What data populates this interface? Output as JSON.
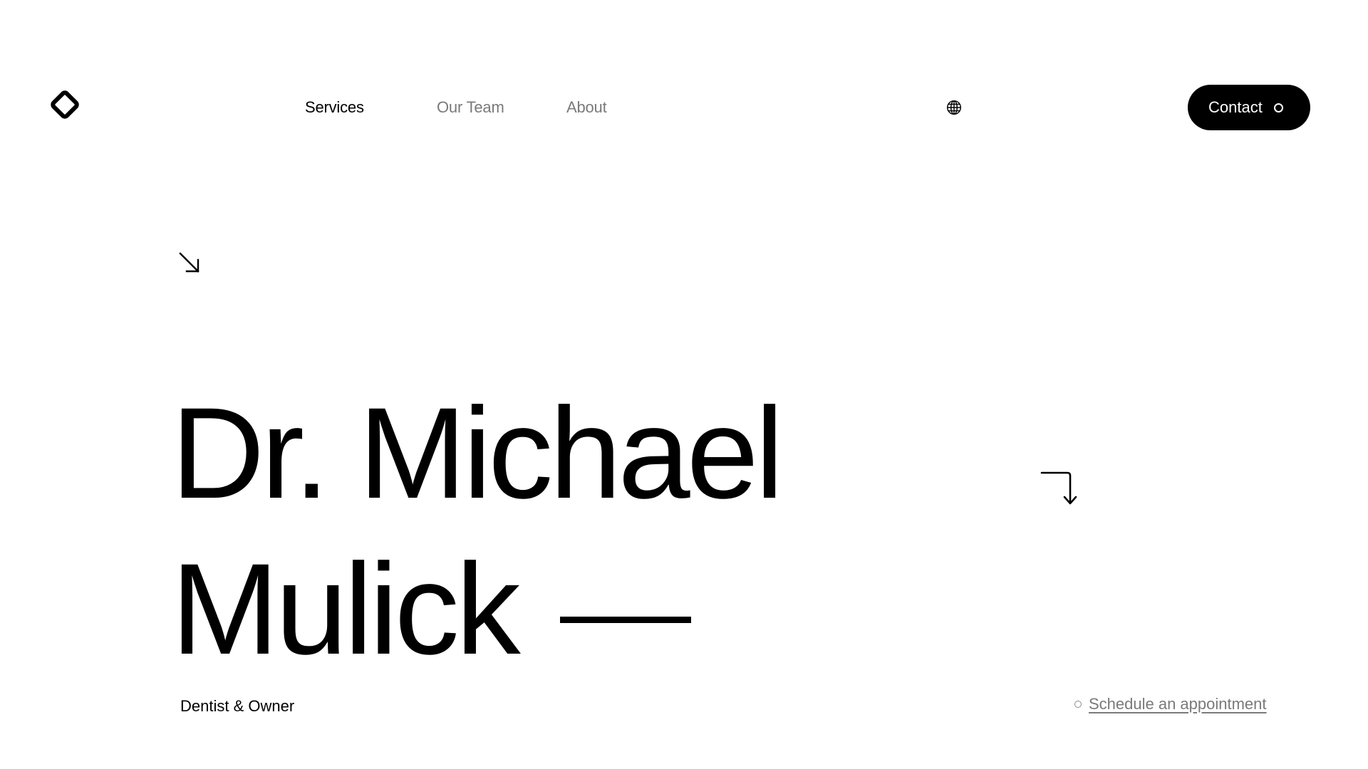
{
  "header": {
    "logo_icon": "diamond-logo-icon",
    "nav": [
      {
        "label": "Services",
        "active": true
      },
      {
        "label": "Our Team",
        "active": false
      },
      {
        "label": "About",
        "active": false
      }
    ],
    "language_icon": "globe-icon",
    "contact_label": "Contact"
  },
  "hero": {
    "name_line1": "Dr. Michael",
    "name_line2": "Mulick",
    "role": "Dentist & Owner",
    "schedule_label": "Schedule an appointment",
    "icons": [
      "arrow-down-right-icon",
      "arrow-turn-down-icon",
      "circle-icon"
    ]
  },
  "colors": {
    "background": "#ffffff",
    "text": "#000000",
    "muted": "#7a7a7a",
    "button": "#000000"
  }
}
